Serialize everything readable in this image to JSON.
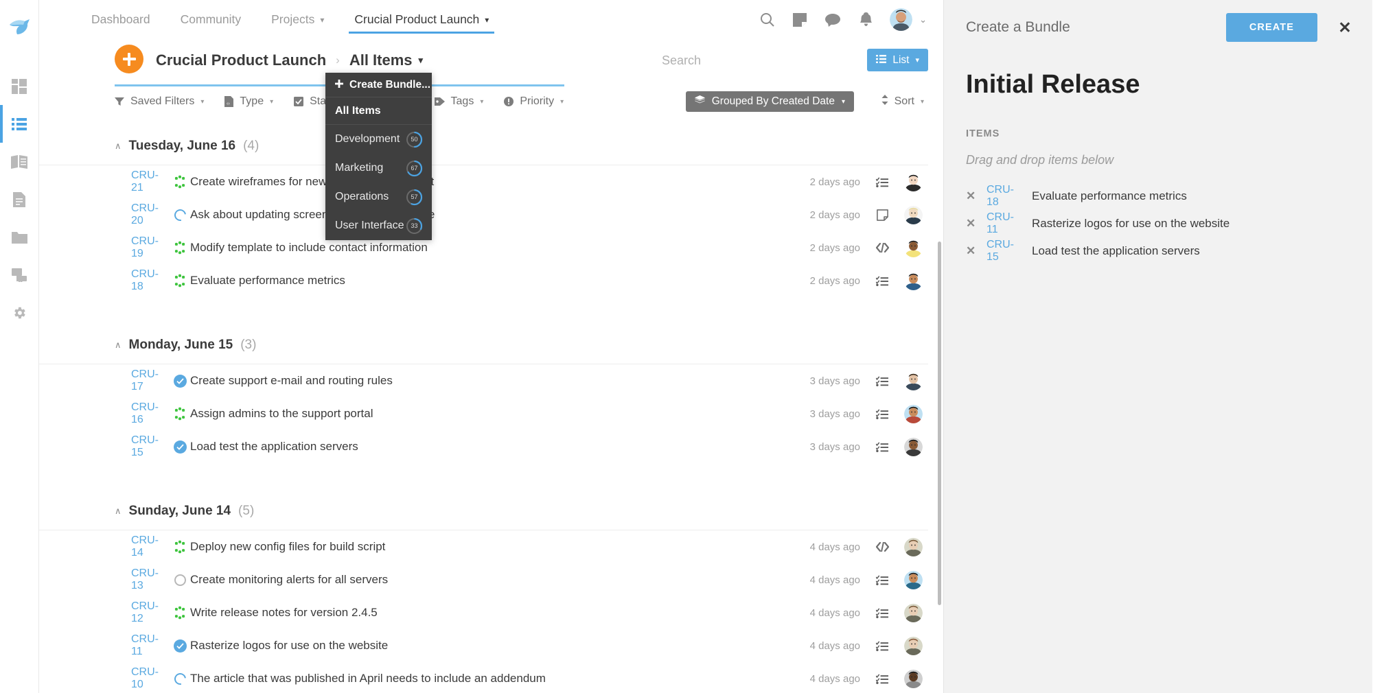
{
  "rail": {
    "logo_icon": "bird-logo",
    "items": [
      {
        "icon": "dashboard-grid-icon",
        "name": "dashboard",
        "active": false
      },
      {
        "icon": "list-icon",
        "name": "items",
        "active": true
      },
      {
        "icon": "book-icon",
        "name": "wiki",
        "active": false
      },
      {
        "icon": "document-icon",
        "name": "documents",
        "active": false
      },
      {
        "icon": "folder-icon",
        "name": "files",
        "active": false
      },
      {
        "icon": "chat-icon",
        "name": "discussions",
        "active": false
      },
      {
        "icon": "gear-icon",
        "name": "settings",
        "active": false
      }
    ]
  },
  "topnav": {
    "tabs": [
      {
        "label": "Dashboard",
        "has_caret": false,
        "active": false
      },
      {
        "label": "Community",
        "has_caret": false,
        "active": false
      },
      {
        "label": "Projects",
        "has_caret": true,
        "active": false
      },
      {
        "label": "Crucial Product Launch",
        "has_caret": true,
        "active": true
      }
    ],
    "icons": [
      "search-icon",
      "note-icon",
      "chat-icon",
      "bell-icon"
    ],
    "avatar_name": "user-avatar",
    "avatar_caret": "⌄"
  },
  "breadcrumb": {
    "add_button_label": "+",
    "project": "Crucial Product Launch",
    "separator": "›",
    "view": "All Items",
    "caret": "▾"
  },
  "search": {
    "placeholder": "Search",
    "value": ""
  },
  "view_button": {
    "label": "List",
    "icon": "list-icon",
    "caret": "▾",
    "color": "#5aa9e0"
  },
  "filters": [
    {
      "label": "Saved Filters",
      "icon": "funnel-icon"
    },
    {
      "label": "Type",
      "icon": "type-icon"
    },
    {
      "label": "Status",
      "icon": "checkbox-icon"
    },
    {
      "label": "Tags",
      "icon": "tag-icon"
    },
    {
      "label": "Priority",
      "icon": "priority-icon"
    }
  ],
  "grouping": {
    "label": "Grouped By Created Date",
    "icon": "layers-icon",
    "caret": "▾"
  },
  "sort": {
    "label": "Sort",
    "icon": "sort-icon",
    "caret": "▾"
  },
  "dropdown": {
    "create_label": "Create Bundle...",
    "create_icon": "plus-icon",
    "all_items_label": "All Items",
    "bundles": [
      {
        "label": "Development",
        "count": "50",
        "percent": 50
      },
      {
        "label": "Marketing",
        "count": "67",
        "percent": 67
      },
      {
        "label": "Operations",
        "count": "57",
        "percent": 57
      },
      {
        "label": "User Interface",
        "count": "33",
        "percent": 33
      }
    ]
  },
  "groups": [
    {
      "title": "Tuesday, June 16",
      "count": "(4)",
      "chevron": "∧",
      "rows": [
        {
          "key": "CRU-21",
          "status": "in-progress",
          "title": "Create wireframes for new Site Design concept",
          "age": "2 days ago",
          "type": "checklist-icon",
          "avatar": "av1"
        },
        {
          "key": "CRU-20",
          "status": "open",
          "title": "Ask about updating screenshots on the website",
          "age": "2 days ago",
          "type": "note-icon",
          "avatar": "av2"
        },
        {
          "key": "CRU-19",
          "status": "in-progress",
          "title": "Modify template to include contact information",
          "age": "2 days ago",
          "type": "code-icon",
          "avatar": "av3"
        },
        {
          "key": "CRU-18",
          "status": "in-progress",
          "title": "Evaluate performance metrics",
          "age": "2 days ago",
          "type": "checklist-icon",
          "avatar": "av4"
        }
      ]
    },
    {
      "title": "Monday, June 15",
      "count": "(3)",
      "chevron": "∧",
      "rows": [
        {
          "key": "CRU-17",
          "status": "done",
          "title": "Create support e-mail and routing rules",
          "age": "3 days ago",
          "type": "checklist-icon",
          "avatar": "av5"
        },
        {
          "key": "CRU-16",
          "status": "in-progress",
          "title": "Assign admins to the support portal",
          "age": "3 days ago",
          "type": "checklist-icon",
          "avatar": "av6"
        },
        {
          "key": "CRU-15",
          "status": "done",
          "title": "Load test the application servers",
          "age": "3 days ago",
          "type": "checklist-icon",
          "avatar": "av7"
        }
      ]
    },
    {
      "title": "Sunday, June 14",
      "count": "(5)",
      "chevron": "∧",
      "rows": [
        {
          "key": "CRU-14",
          "status": "in-progress",
          "title": "Deploy new config files for build script",
          "age": "4 days ago",
          "type": "code-icon",
          "avatar": "av8"
        },
        {
          "key": "CRU-13",
          "status": "new",
          "title": "Create monitoring alerts for all servers",
          "age": "4 days ago",
          "type": "checklist-icon",
          "avatar": "av9"
        },
        {
          "key": "CRU-12",
          "status": "in-progress",
          "title": "Write release notes for version 2.4.5",
          "age": "4 days ago",
          "type": "checklist-icon",
          "avatar": "av10"
        },
        {
          "key": "CRU-11",
          "status": "done",
          "title": "Rasterize logos for use on the website",
          "age": "4 days ago",
          "type": "checklist-icon",
          "avatar": "av11"
        },
        {
          "key": "CRU-10",
          "status": "open",
          "title": "The article that was published in April needs to include an addendum",
          "age": "4 days ago",
          "type": "checklist-icon",
          "avatar": "av12"
        }
      ]
    }
  ],
  "panel": {
    "title": "Create a Bundle",
    "create_label": "CREATE",
    "close_label": "✕",
    "bundle_name": "Initial Release",
    "items_label": "ITEMS",
    "drag_hint": "Drag and drop items below",
    "items": [
      {
        "remove": "✕",
        "key": "CRU-18",
        "title": "Evaluate performance metrics"
      },
      {
        "remove": "✕",
        "key": "CRU-11",
        "title": "Rasterize logos for use on the website"
      },
      {
        "remove": "✕",
        "key": "CRU-15",
        "title": "Load test the application servers"
      }
    ]
  },
  "colors": {
    "accent_blue": "#5aa9e0",
    "orange": "#f68b1f",
    "progress_green": "#3ec43e",
    "menu_dark": "#3f3f3f",
    "panel_bg": "#f2f2f2"
  }
}
